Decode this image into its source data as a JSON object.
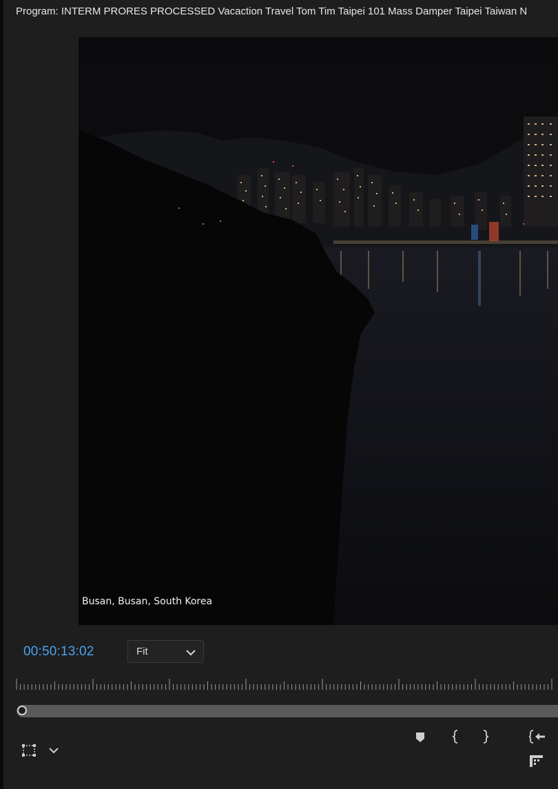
{
  "panel": {
    "title": "Program: INTERM PRORES PROCESSED Vacaction Travel Tom Tim Taipei 101 Mass Damper Taipei Taiwan N"
  },
  "video": {
    "caption": "Busan, Busan, South Korea"
  },
  "controls": {
    "timecode": "00:50:13:02",
    "zoom_value": "Fit",
    "timecode_color": "#4aa3f0"
  },
  "icons": {
    "safe_margins": "safe-margins-icon",
    "settings_dropdown": "chevron-down-icon",
    "add_marker": "marker-icon",
    "mark_in": "mark-in-icon",
    "mark_out": "mark-out-icon",
    "go_to_in": "go-to-in-icon",
    "export_frame": "export-frame-icon"
  }
}
